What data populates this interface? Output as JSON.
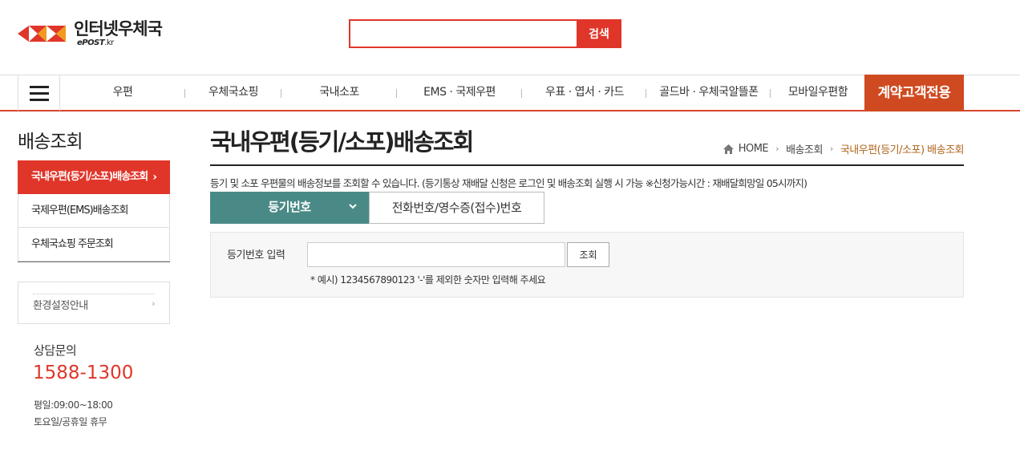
{
  "header": {
    "logo_text_kor": "인터넷우체국",
    "logo_text_en": "ePOST",
    "logo_text_en_suffix": ".kr",
    "search_placeholder": "",
    "search_button": "검색"
  },
  "gnb": {
    "items": [
      "우편",
      "우체국쇼핑",
      "국내소포",
      "EMS · 국제우편",
      "우표 · 엽서 · 카드",
      "골드바 · 우체국알뜰폰",
      "모바일우편함"
    ],
    "special": "계약고객전용"
  },
  "sidebar": {
    "title": "배송조회",
    "items": [
      "국내우편(등기/소포)배송조회",
      "국제우편(EMS)배송조회",
      "우체국쇼핑 주문조회"
    ],
    "active_index": 0,
    "env_link": "환경설정안내",
    "consult_title": "상담문의",
    "consult_phone": "1588-1300",
    "hours_weekday": "평일:09:00~18:00",
    "hours_weekend": "토요일/공휴일 휴무"
  },
  "main": {
    "title": "국내우편(등기/소포)배송조회",
    "breadcrumb": [
      "HOME",
      "배송조회",
      "국내우편(등기/소포) 배송조회"
    ],
    "description": "등기 및 소포 우편물의 배송정보를 조회할 수 있습니다. (등기통상 재배달 신청은 로그인 및 배송조회 실행 시 가능 ※신청가능시간 : 재배달희망일 05시까지)",
    "tabs": [
      "등기번호",
      "전화번호/영수증(접수)번호"
    ],
    "form_label": "등기번호 입력",
    "form_input_value": "",
    "form_button": "조회",
    "form_note": "* 예시) 1234567890123 '-'를 제외한 숫자만 입력해 주세요"
  },
  "colors": {
    "accent_red": "#e0362a",
    "special_orange": "#cf4a20",
    "tab_teal": "#4a8a86",
    "breadcrumb_current": "#b0641a"
  },
  "icons": [
    "epost-logo-icon",
    "hamburger-menu-icon",
    "home-icon",
    "chevron-right-icon",
    "chevron-down-icon"
  ]
}
